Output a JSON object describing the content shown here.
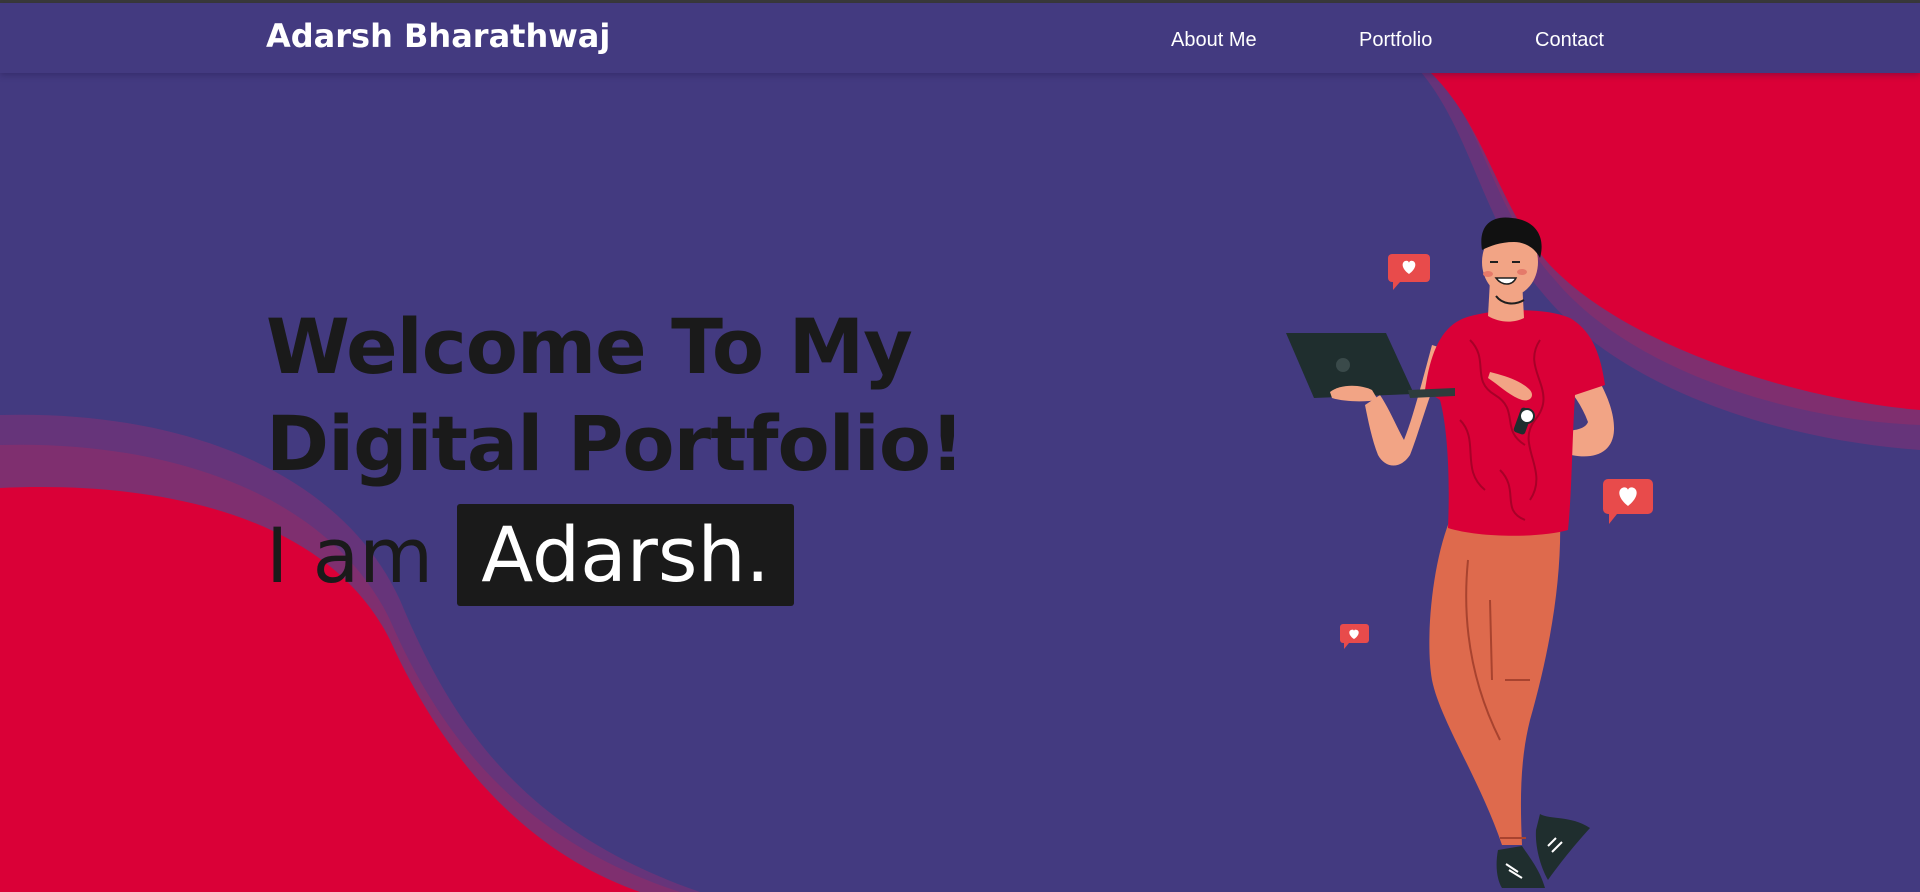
{
  "navbar": {
    "brand": "Adarsh Bharathwaj",
    "links": [
      "About Me",
      "Portfolio",
      "Contact"
    ]
  },
  "hero": {
    "title": "Welcome To My Digital Portfolio!",
    "intro": "I am",
    "name": "Adarsh."
  },
  "illustration": {
    "icons": [
      "heart-bubble-icon",
      "heart-bubble-icon",
      "heart-bubble-icon"
    ]
  },
  "colors": {
    "background": "#433A80",
    "accent": "#DA0037",
    "text_dark": "#1A1A1A",
    "name_highlight": "#1A1A1A"
  }
}
